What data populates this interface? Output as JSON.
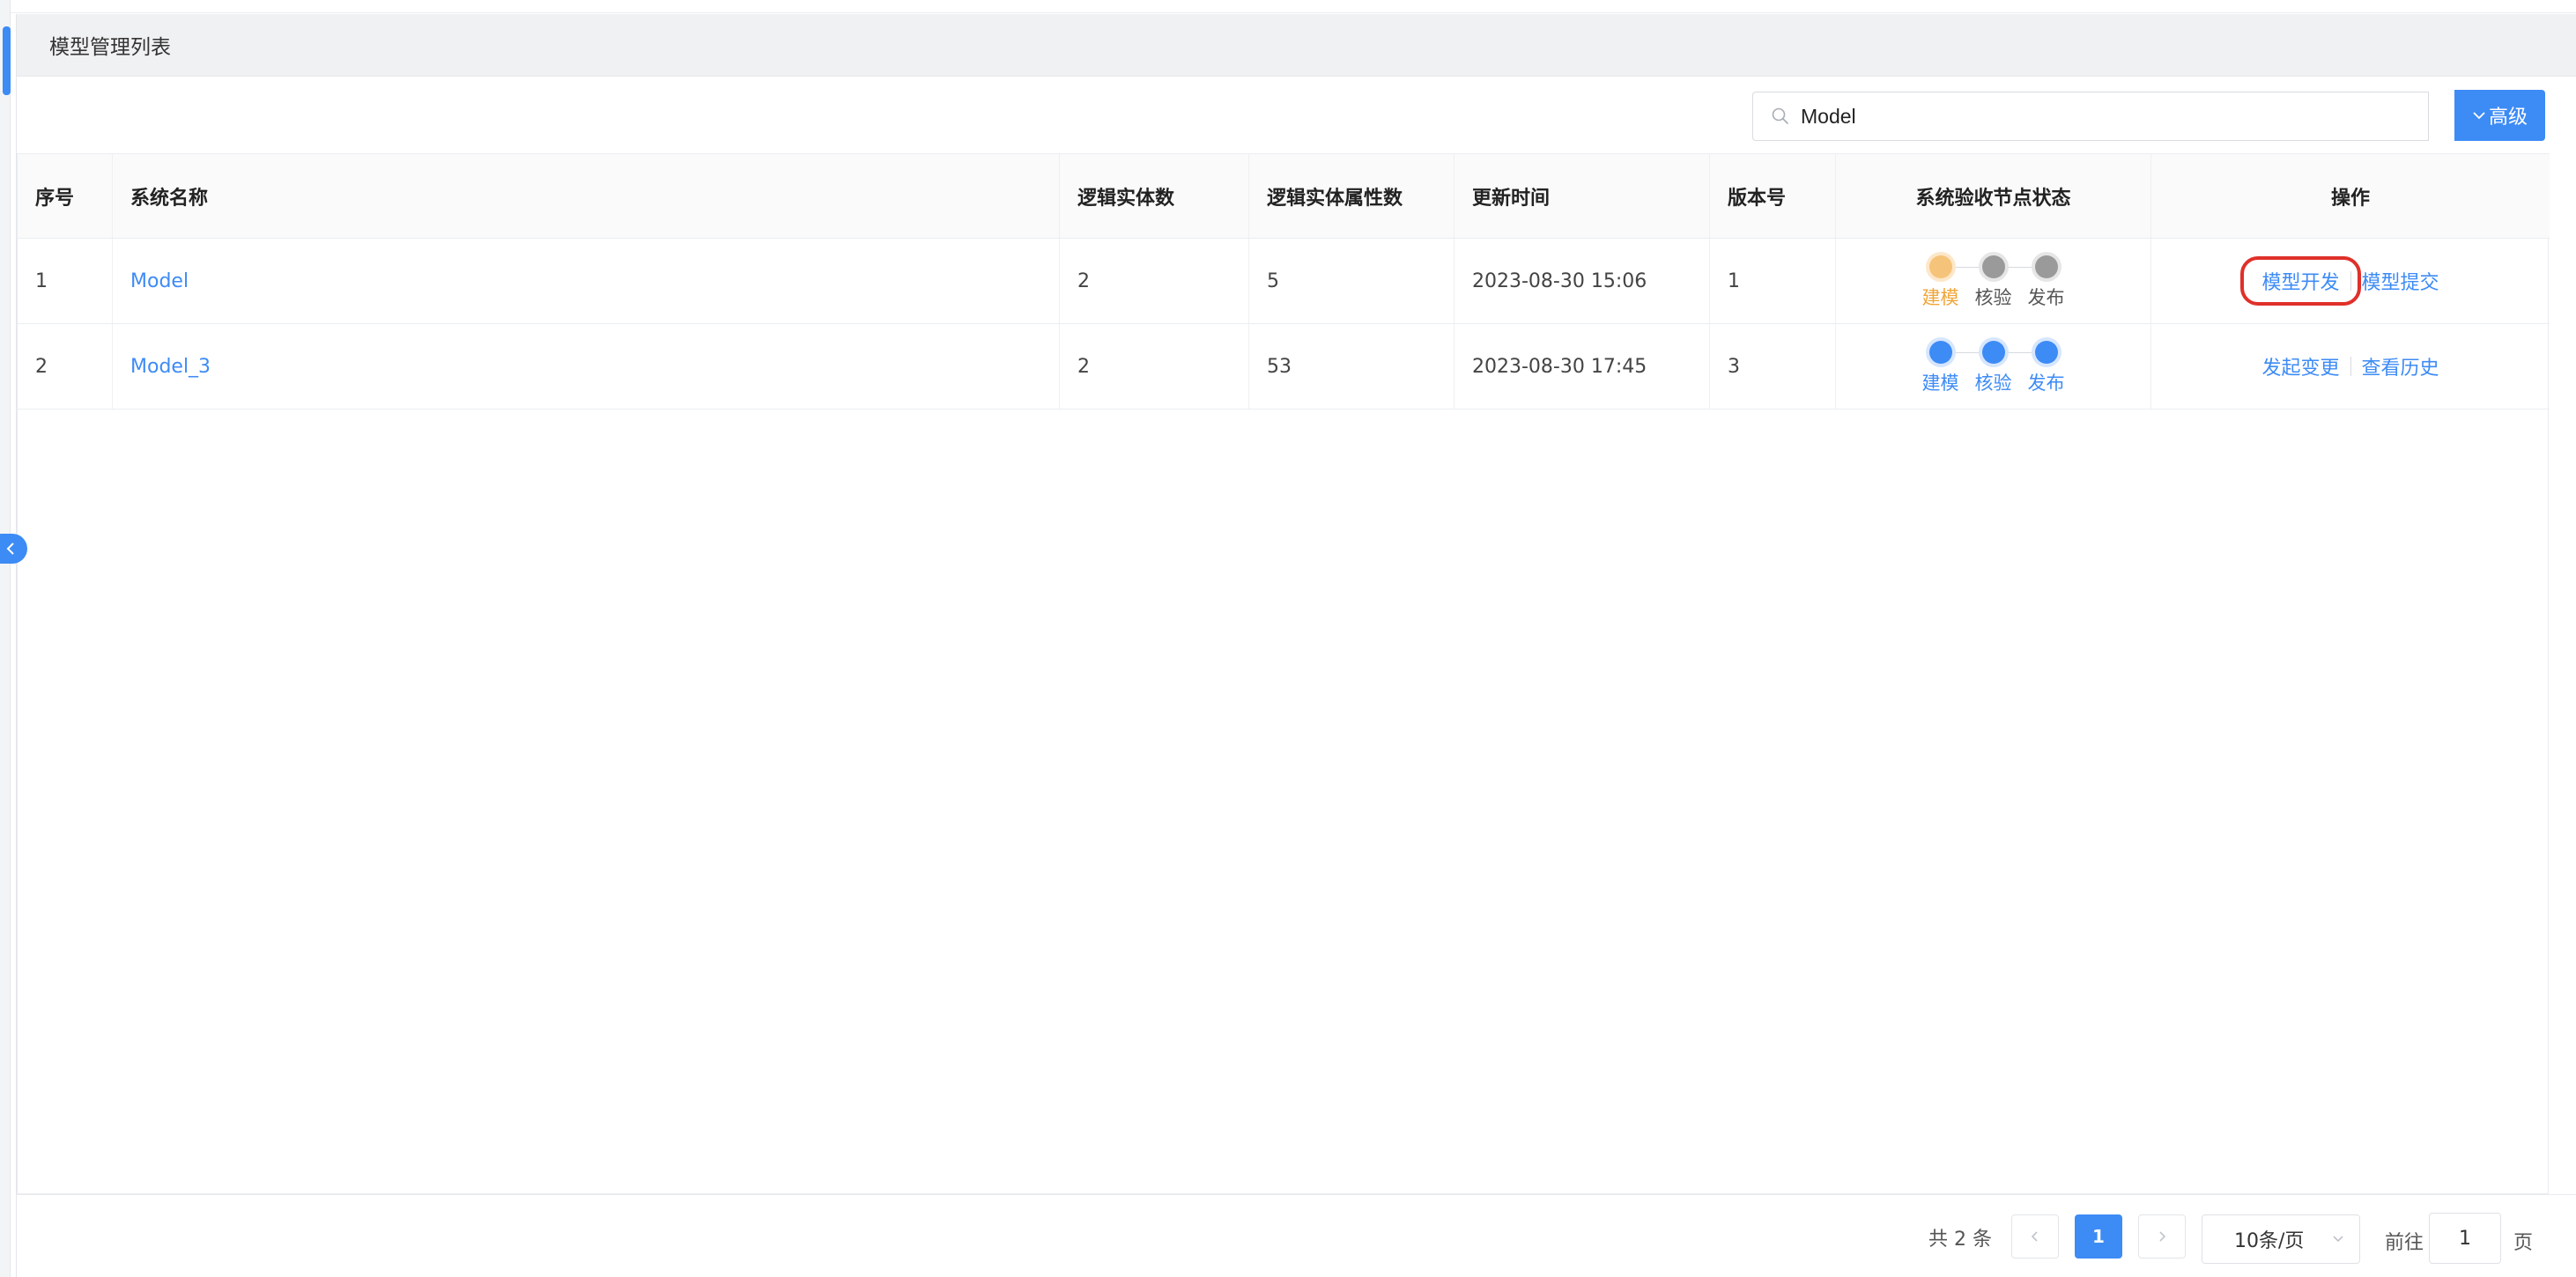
{
  "panel": {
    "title": "模型管理列表"
  },
  "search": {
    "value": "Model",
    "advanced_label": "高级"
  },
  "table": {
    "headers": [
      "序号",
      "系统名称",
      "逻辑实体数",
      "逻辑实体属性数",
      "更新时间",
      "版本号",
      "系统验收节点状态",
      "操作"
    ],
    "rows": [
      {
        "index": "1",
        "name": "Model",
        "entities": "2",
        "attributes": "5",
        "updated": "2023-08-30 15:06",
        "version": "1",
        "steps": [
          {
            "label": "建模",
            "status": "in-progress",
            "color": "#f0a63a"
          },
          {
            "label": "核验",
            "status": "pending",
            "color": "#9a9a9a"
          },
          {
            "label": "发布",
            "status": "pending",
            "color": "#9a9a9a"
          }
        ],
        "actions": [
          "模型开发",
          "模型提交"
        ]
      },
      {
        "index": "2",
        "name": "Model_3",
        "entities": "2",
        "attributes": "53",
        "updated": "2023-08-30 17:45",
        "version": "3",
        "steps": [
          {
            "label": "建模",
            "status": "done",
            "color": "#3d8bf5"
          },
          {
            "label": "核验",
            "status": "done",
            "color": "#3d8bf5"
          },
          {
            "label": "发布",
            "status": "done",
            "color": "#3d8bf5"
          }
        ],
        "actions": [
          "发起变更",
          "查看历史"
        ]
      }
    ]
  },
  "pagination": {
    "total_text": "共 2 条",
    "current_page": "1",
    "page_size": "10条/页",
    "goto_label": "前往",
    "goto_value": "1",
    "page_suffix": "页"
  },
  "colors": {
    "accent": "#3d8bf5",
    "highlight_box": "#e0302a",
    "in_progress": "#f0a63a"
  },
  "icons": {
    "search": "search-icon",
    "advanced": "chevron-down-icon",
    "collapse": "chevron-left-icon",
    "prev": "chevron-left-icon",
    "next": "chevron-right-icon"
  }
}
